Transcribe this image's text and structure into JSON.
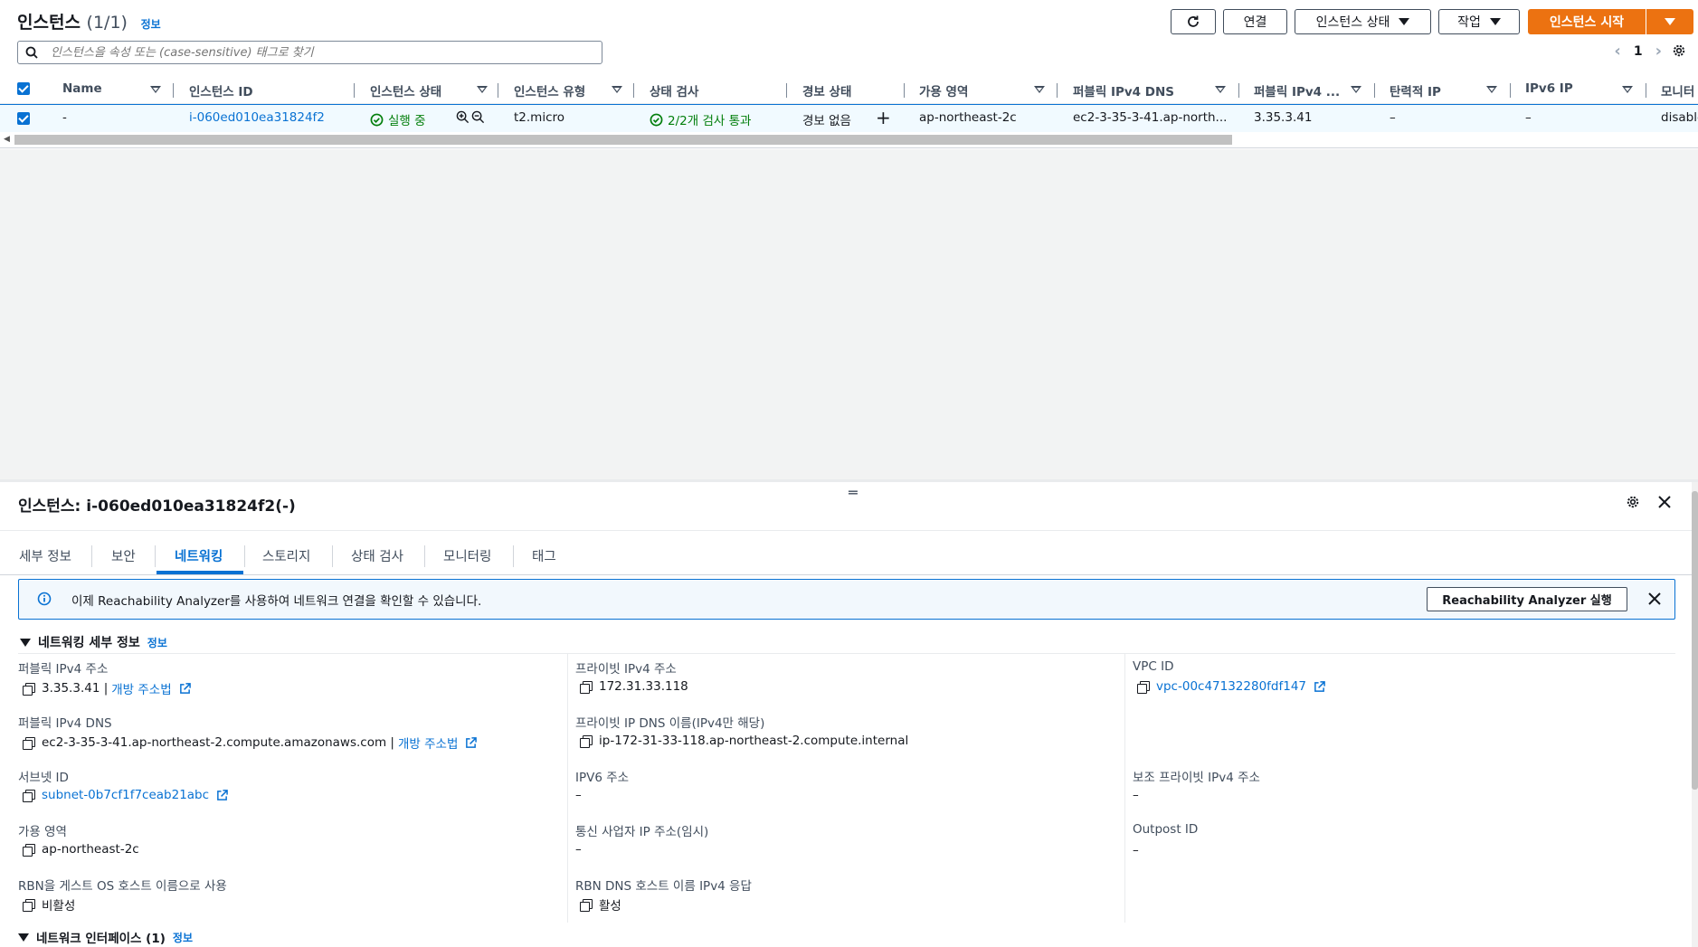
{
  "header": {
    "title": "인스턴스",
    "count": "(1/1)",
    "info": "정보",
    "buttons": {
      "connect": "연결",
      "instance_state": "인스턴스 상태",
      "actions": "작업",
      "launch": "인스턴스 시작"
    },
    "search_placeholder": "인스턴스을 속성 또는 (case-sensitive) 태그로 찾기",
    "page": "1"
  },
  "table": {
    "columns": [
      "Name",
      "인스턴스 ID",
      "인스턴스 상태",
      "인스턴스 유형",
      "상태 검사",
      "경보 상태",
      "가용 영역",
      "퍼블릭 IPv4 DNS",
      "퍼블릭 IPv4 ...",
      "탄력적 IP",
      "IPv6 IP",
      "모니터"
    ],
    "row": {
      "name": "-",
      "instance_id": "i-060ed010ea31824f2",
      "state": "실행 중",
      "type": "t2.micro",
      "status_check": "2/2개 검사 통과",
      "alarm": "경보 없음",
      "az": "ap-northeast-2c",
      "public_dns": "ec2-3-35-3-41.ap-north...",
      "public_ip": "3.35.3.41",
      "elastic_ip": "–",
      "ipv6": "–",
      "monitoring": "disable"
    }
  },
  "details": {
    "title": "인스턴스: i-060ed010ea31824f2(-)",
    "tabs": [
      "세부 정보",
      "보안",
      "네트워킹",
      "스토리지",
      "상태 검사",
      "모니터링",
      "태그"
    ],
    "active_tab": "네트워킹",
    "banner": {
      "text": "이제 Reachability Analyzer를 사용하여 네트워크 연결을 확인할 수 있습니다.",
      "button": "Reachability Analyzer 실행"
    },
    "network_section": {
      "title": "네트워킹 세부 정보",
      "info": "정보"
    },
    "fields": {
      "public_ipv4_label": "퍼블릭 IPv4 주소",
      "public_ipv4_value": "3.35.3.41 |",
      "open_address": "개방 주소법",
      "private_ipv4_label": "프라이빗 IPv4 주소",
      "private_ipv4_value": "172.31.33.118",
      "vpc_label": "VPC ID",
      "vpc_value": "vpc-00c47132280fdf147",
      "public_dns_label": "퍼블릭 IPv4 DNS",
      "public_dns_value": "ec2-3-35-3-41.ap-northeast-2.compute.amazonaws.com |",
      "private_dns_label": "프라이빗 IP DNS 이름(IPv4만 해당)",
      "private_dns_value": "ip-172-31-33-118.ap-northeast-2.compute.internal",
      "subnet_label": "서브넷 ID",
      "subnet_value": "subnet-0b7cf1f7ceab21abc",
      "ipv6_label": "IPV6 주소",
      "ipv6_value": "–",
      "secondary_label": "보조 프라이빗 IPv4 주소",
      "secondary_value": "–",
      "az_label": "가용 영역",
      "az_value": "ap-northeast-2c",
      "carrier_label": "통신 사업자 IP 주소(임시)",
      "carrier_value": "–",
      "outpost_label": "Outpost ID",
      "outpost_value": "–",
      "rbn_label": "RBN을 게스트 OS 호스트 이름으로 사용",
      "rbn_value": "비활성",
      "rbn_dns_label": "RBN DNS 호스트 이름 IPv4 응답",
      "rbn_dns_value": "활성"
    },
    "interfaces_section": {
      "title": "네트워크 인터페이스 (1)",
      "info": "정보"
    }
  }
}
